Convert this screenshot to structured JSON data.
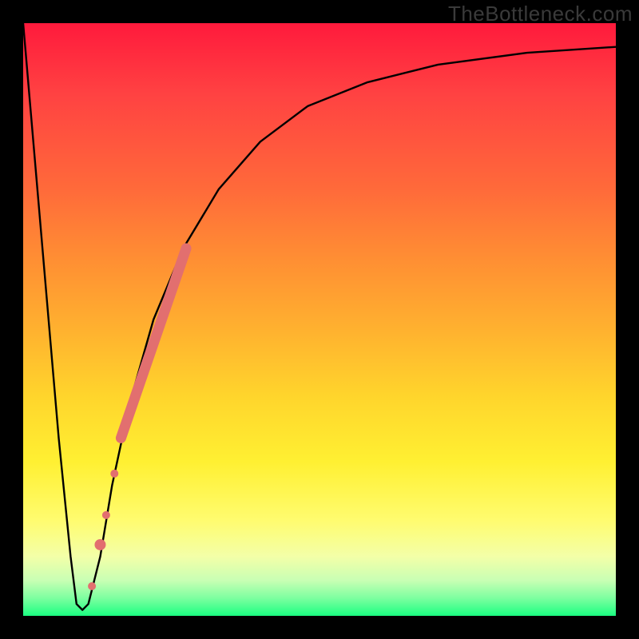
{
  "watermark": "TheBottleneck.com",
  "chart_data": {
    "type": "line",
    "title": "",
    "xlabel": "",
    "ylabel": "",
    "xlim": [
      0,
      100
    ],
    "ylim": [
      0,
      100
    ],
    "series": [
      {
        "name": "bottleneck-curve",
        "x": [
          0,
          6,
          8,
          9,
          10,
          11,
          13,
          15,
          18,
          22,
          27,
          33,
          40,
          48,
          58,
          70,
          85,
          100
        ],
        "y": [
          100,
          30,
          10,
          2,
          1,
          2,
          10,
          22,
          36,
          50,
          62,
          72,
          80,
          86,
          90,
          93,
          95,
          96
        ]
      }
    ],
    "markers": [
      {
        "name": "highlight-segment",
        "shape": "round-line",
        "color": "#e26f6f",
        "x": [
          16.5,
          27.5
        ],
        "y": [
          30,
          62
        ]
      },
      {
        "name": "dot-1",
        "shape": "circle",
        "color": "#e26f6f",
        "x": 15.4,
        "y": 24,
        "r": 5
      },
      {
        "name": "dot-2",
        "shape": "circle",
        "color": "#e26f6f",
        "x": 14.0,
        "y": 17,
        "r": 5
      },
      {
        "name": "dot-3",
        "shape": "circle",
        "color": "#e26f6f",
        "x": 13.0,
        "y": 12,
        "r": 7
      },
      {
        "name": "dot-4",
        "shape": "circle",
        "color": "#e26f6f",
        "x": 11.6,
        "y": 5,
        "r": 5
      }
    ],
    "gradient_stops": [
      {
        "pos": 0.0,
        "color": "#ff1a3c"
      },
      {
        "pos": 0.5,
        "color": "#ffb22f"
      },
      {
        "pos": 0.8,
        "color": "#fff032"
      },
      {
        "pos": 1.0,
        "color": "#1bff81"
      }
    ]
  }
}
